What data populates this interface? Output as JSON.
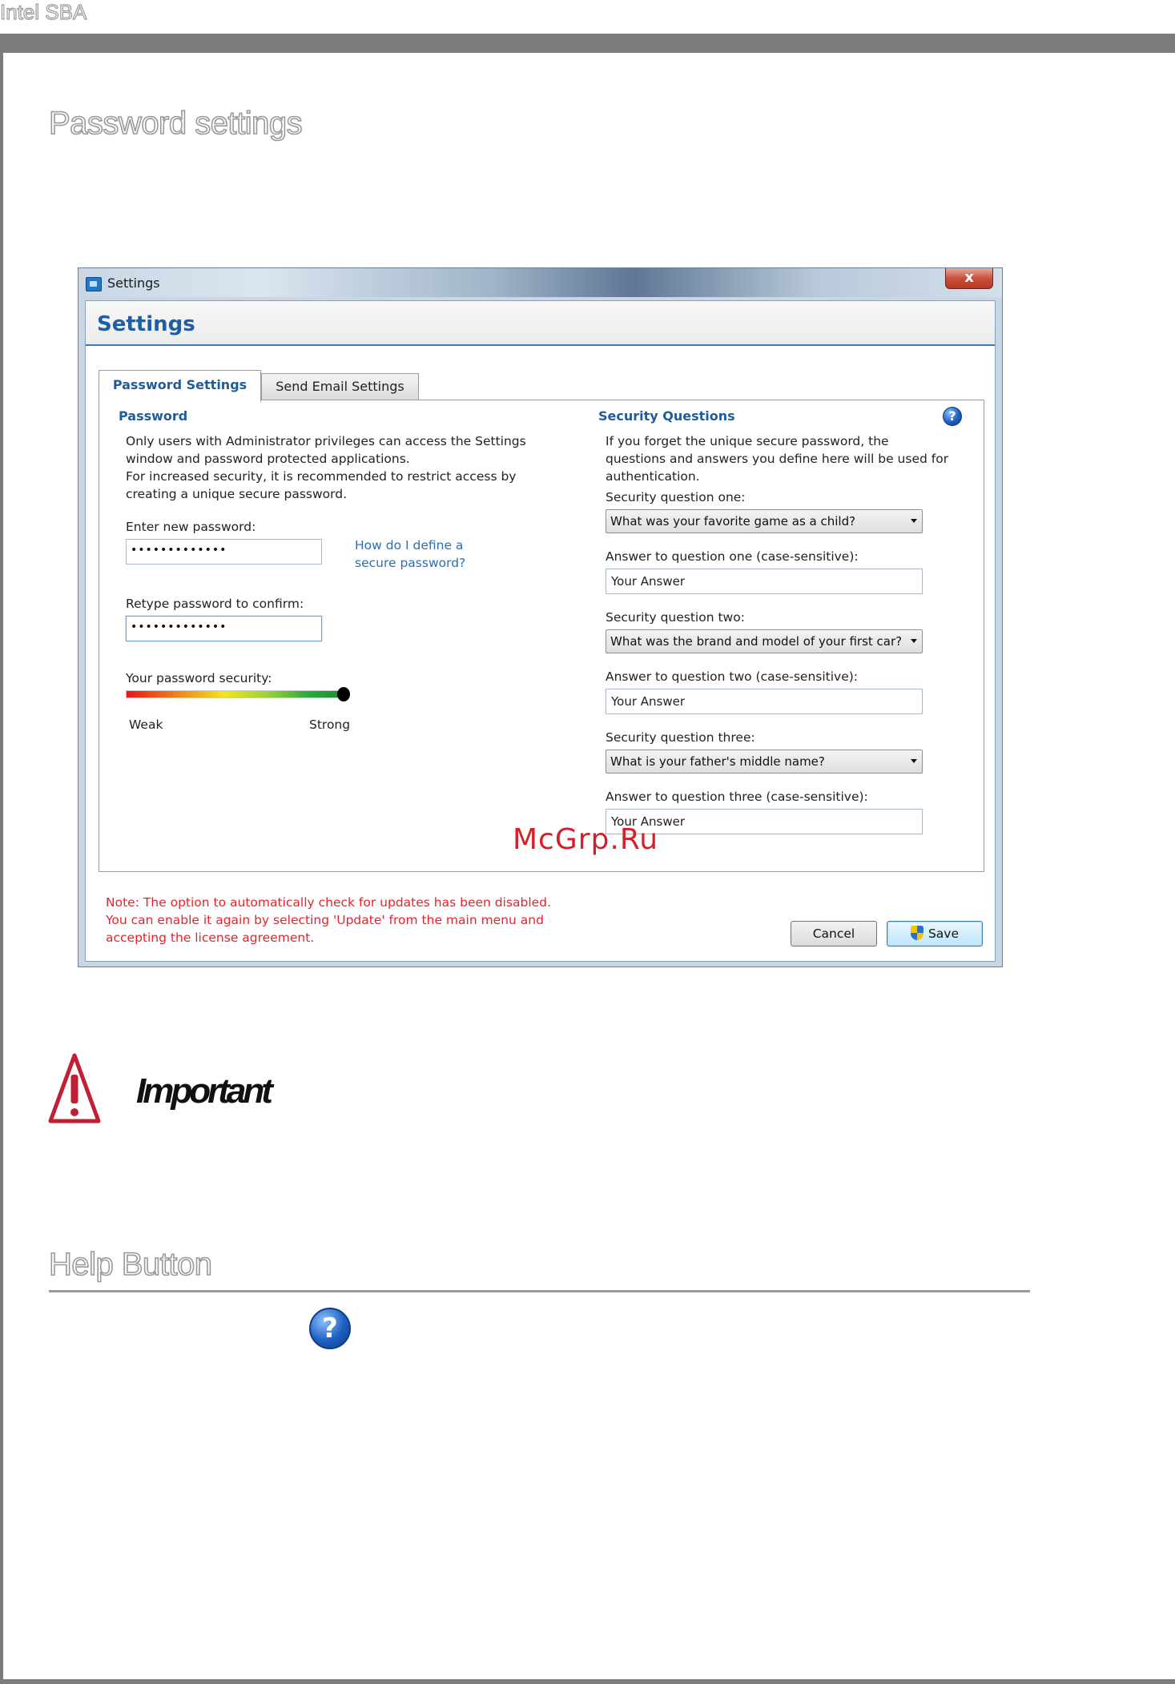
{
  "document": {
    "running_header": "Intel SBA",
    "section_password": "Password settings",
    "section_help": "Help Button",
    "important_label": "Important",
    "watermark": "McGrp.Ru"
  },
  "window": {
    "title": "Settings",
    "close_glyph": "x",
    "header_title": "Settings",
    "tabs": [
      {
        "label": "Password Settings",
        "active": true
      },
      {
        "label": "Send Email Settings",
        "active": false
      }
    ],
    "password": {
      "title": "Password",
      "intro_lines": [
        "Only users with Administrator privileges can access the Settings",
        "window and password protected applications.",
        "For increased security, it is recommended to restrict access by",
        "creating a unique secure password."
      ],
      "new_label": "Enter new password:",
      "new_value": "•••••••••••••",
      "help_link_lines": [
        "How do I define a",
        "secure password?"
      ],
      "confirm_label": "Retype password to confirm:",
      "confirm_value": "•••••••••••••",
      "security_label": "Your password security:",
      "strength_fraction": 1.0,
      "weak_label": "Weak",
      "strong_label": "Strong"
    },
    "security": {
      "title": "Security Questions",
      "intro_lines": [
        "If you forget the unique secure password, the",
        "questions and answers you define here will be used for",
        "authentication."
      ],
      "q1_label": "Security question one:",
      "q1_value": "What was your favorite game as a child?",
      "a1_label": "Answer to question one (case-sensitive):",
      "a1_value": "Your Answer",
      "q2_label": "Security question two:",
      "q2_value": "What was the brand and model of your first car?",
      "a2_label": "Answer to question two (case-sensitive):",
      "a2_value": "Your Answer",
      "q3_label": "Security question three:",
      "q3_value": "What is your father's middle name?",
      "a3_label": "Answer to question three (case-sensitive):",
      "a3_value": "Your Answer"
    },
    "note_lines": [
      "Note: The option to automatically check for updates has been disabled.",
      "You can enable it again by selecting 'Update' from the main menu and",
      "accepting the license agreement."
    ],
    "cancel_label": "Cancel",
    "save_label": "Save",
    "help_glyph": "?"
  },
  "icons": {
    "warning": "warning-triangle-icon",
    "help": "help-icon",
    "shield": "uac-shield-icon",
    "app": "settings-app-icon"
  },
  "colors": {
    "accent_blue": "#1d5fa5",
    "note_red": "#e8222a",
    "warning_red": "#c21f35",
    "rule_gray": "#7c7c7c"
  }
}
